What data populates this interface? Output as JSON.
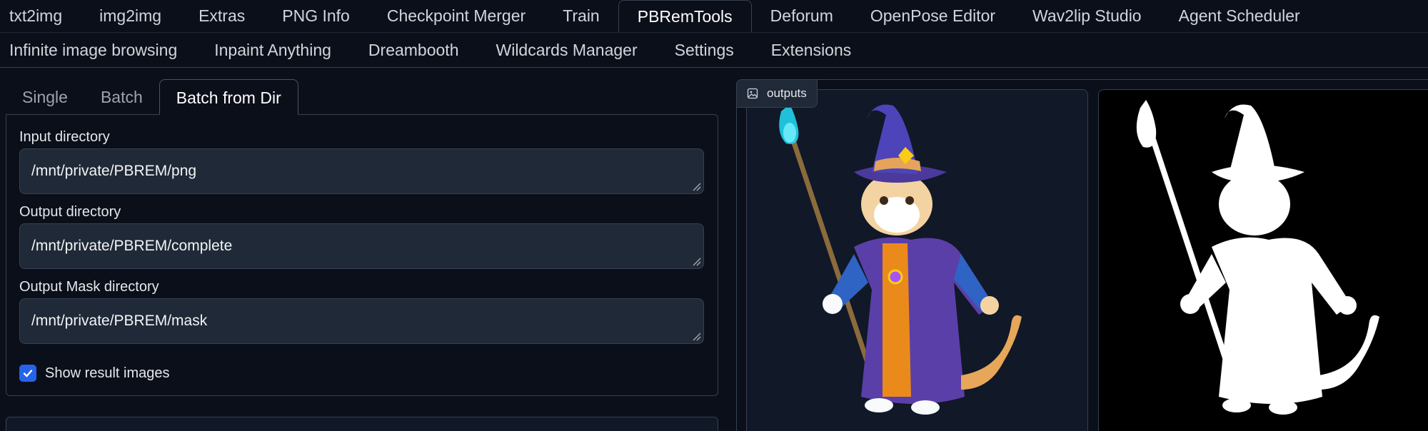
{
  "top_tabs_row1": [
    "txt2img",
    "img2img",
    "Extras",
    "PNG Info",
    "Checkpoint Merger",
    "Train",
    "PBRemTools",
    "Deforum",
    "OpenPose Editor",
    "Wav2lip Studio",
    "Agent Scheduler"
  ],
  "top_tabs_row2": [
    "Infinite image browsing",
    "Inpaint Anything",
    "Dreambooth",
    "Wildcards Manager",
    "Settings",
    "Extensions"
  ],
  "selected_top_tab": "PBRemTools",
  "sub_tabs": [
    "Single",
    "Batch",
    "Batch from Dir"
  ],
  "selected_sub_tab": "Batch from Dir",
  "fields": {
    "input": {
      "label": "Input directory",
      "value": "/mnt/private/PBREM/png"
    },
    "output": {
      "label": "Output directory",
      "value": "/mnt/private/PBREM/complete"
    },
    "mask": {
      "label": "Output Mask directory",
      "value": "/mnt/private/PBREM/mask"
    }
  },
  "show_result": {
    "label": "Show result images",
    "checked": true
  },
  "gallery": {
    "label": "outputs",
    "label_icon": "image-icon"
  },
  "colors": {
    "accent": "#2563eb",
    "background": "#0b0f19",
    "input_bg": "#1f2937"
  }
}
